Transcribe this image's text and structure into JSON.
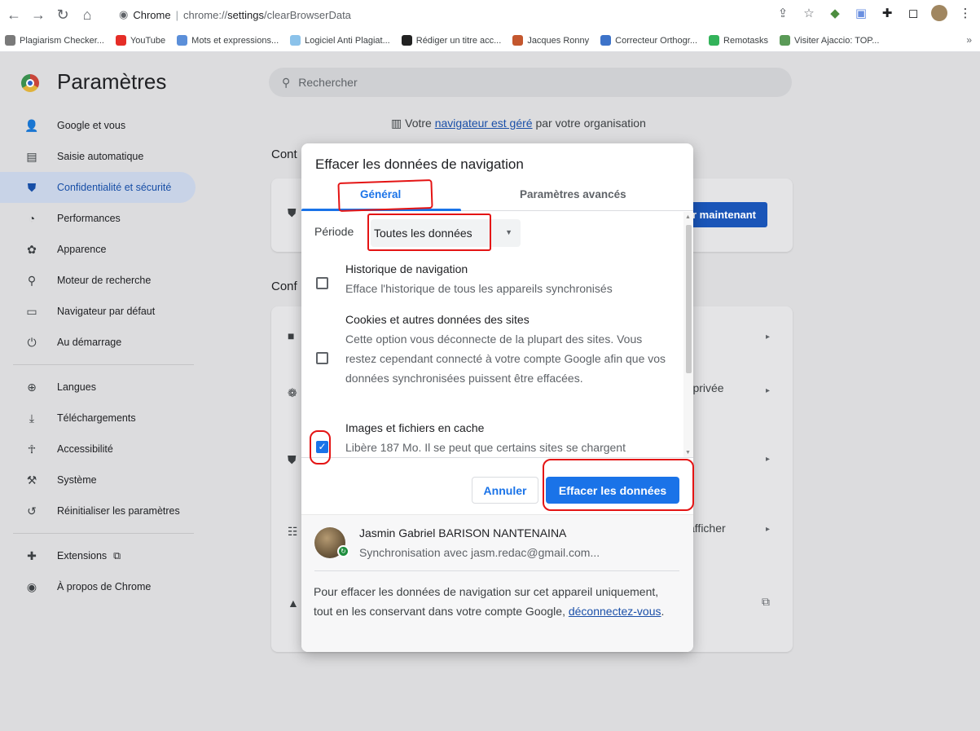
{
  "browser": {
    "site_label": "Chrome",
    "url_prefix": "chrome://",
    "url_host": "settings",
    "url_path": "/clearBrowserData",
    "bookmarks": [
      {
        "label": "Plagiarism Checker...",
        "color": "#7a7a7a"
      },
      {
        "label": "YouTube",
        "color": "#e52d27"
      },
      {
        "label": "Mots et expressions...",
        "color": "#5b8fd9"
      },
      {
        "label": "Logiciel Anti Plagiat...",
        "color": "#8bc2ea"
      },
      {
        "label": "Rédiger un titre acc...",
        "color": "#222222"
      },
      {
        "label": "Jacques Ronny",
        "color": "#c4572e"
      },
      {
        "label": "Correcteur Orthogr...",
        "color": "#3d73c9"
      },
      {
        "label": "Remotasks",
        "color": "#33b35a"
      },
      {
        "label": "Visiter Ajaccio: TOP...",
        "color": "#5a9a57"
      }
    ],
    "bookmarks_more": "»"
  },
  "settings": {
    "title": "Paramètres",
    "search_placeholder": "Rechercher",
    "managed_prefix": "Votre ",
    "managed_link": "navigateur est géré",
    "managed_suffix": " par votre organisation",
    "sidebar": [
      {
        "label": "Google et vous",
        "icon": "person-icon"
      },
      {
        "label": "Saisie automatique",
        "icon": "clipboard-icon"
      },
      {
        "label": "Confidentialité et sécurité",
        "icon": "shield-icon",
        "active": true
      },
      {
        "label": "Performances",
        "icon": "speedometer-icon"
      },
      {
        "label": "Apparence",
        "icon": "palette-icon"
      },
      {
        "label": "Moteur de recherche",
        "icon": "search-icon"
      },
      {
        "label": "Navigateur par défaut",
        "icon": "browser-icon"
      },
      {
        "label": "Au démarrage",
        "icon": "power-icon"
      },
      {
        "label": "Langues",
        "icon": "globe-icon"
      },
      {
        "label": "Téléchargements",
        "icon": "download-icon"
      },
      {
        "label": "Accessibilité",
        "icon": "accessibility-icon"
      },
      {
        "label": "Système",
        "icon": "wrench-icon"
      },
      {
        "label": "Réinitialiser les paramètres",
        "icon": "reset-icon"
      },
      {
        "label": "Extensions",
        "icon": "puzzle-icon"
      },
      {
        "label": "À propos de Chrome",
        "icon": "chrome-icon"
      }
    ],
    "section_label_1": "Cont",
    "section_label_2": "Conf",
    "bg_button": "r maintenant",
    "bg_row_private": "on privée",
    "bg_row_afficher": "afficher"
  },
  "dialog": {
    "title": "Effacer les données de navigation",
    "tabs": [
      "Général",
      "Paramètres avancés"
    ],
    "period_label": "Période",
    "period_value": "Toutes les données",
    "options": [
      {
        "title": "Historique de navigation",
        "desc": "Efface l'historique de tous les appareils synchronisés",
        "checked": false
      },
      {
        "title": "Cookies et autres données des sites",
        "desc": "Cette option vous déconnecte de la plupart des sites. Vous restez cependant connecté à votre compte Google afin que vos données synchronisées puissent être effacées.",
        "checked": false
      },
      {
        "title": "Images et fichiers en cache",
        "desc": "Libère 187 Mo. Il se peut que certains sites se chargent",
        "checked": true
      }
    ],
    "cancel_label": "Annuler",
    "confirm_label": "Effacer les données",
    "user_name": "Jasmin Gabriel BARISON NANTENAINA",
    "user_sync": "Synchronisation avec jasm.redac@gmail.com...",
    "footer_text": "Pour effacer les données de navigation sur cet appareil uniquement, tout en les conservant dans votre compte Google, ",
    "footer_link": "déconnectez-vous",
    "footer_end": "."
  },
  "colors": {
    "accent": "#1a73e8",
    "annotation": "#e41414"
  }
}
